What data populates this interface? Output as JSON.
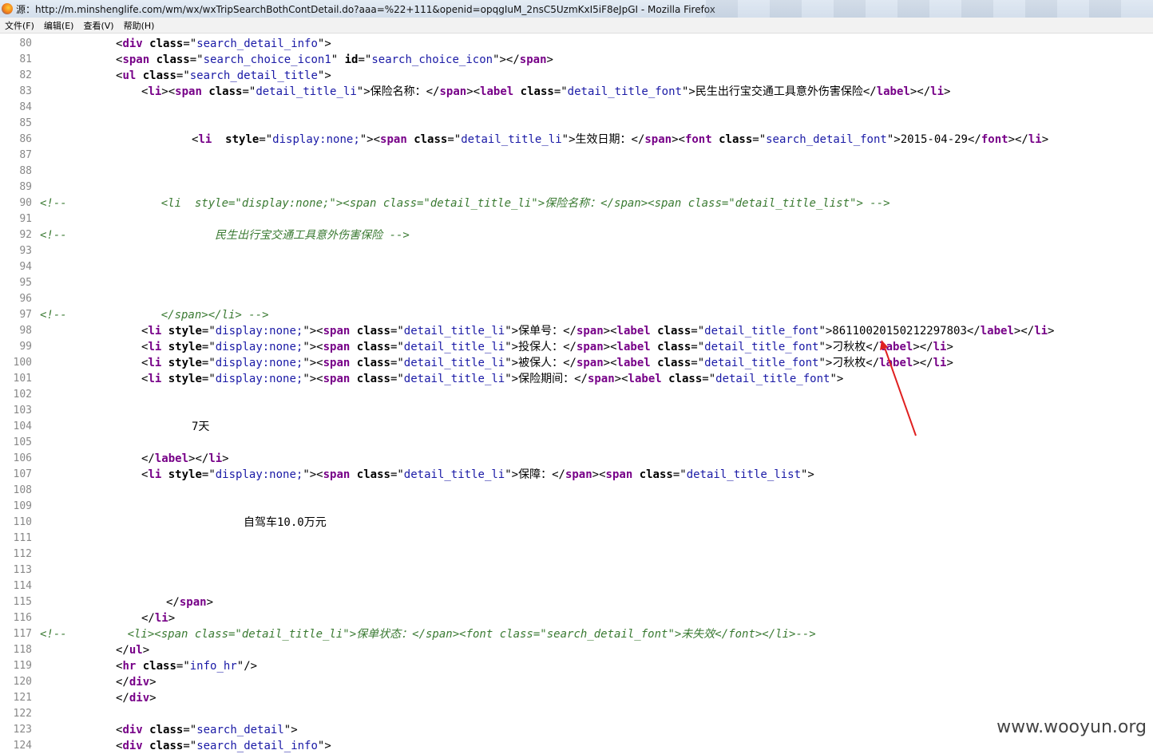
{
  "window": {
    "title": "源：http://m.minshenglife.com/wm/wx/wxTripSearchBothContDetail.do?aaa=%22+111&openid=opqgIuM_2nsC5UzmKxI5iF8eJpGI - Mozilla Firefox"
  },
  "menu": [
    {
      "label": "文件(F)"
    },
    {
      "label": "编辑(E)"
    },
    {
      "label": "查看(V)"
    },
    {
      "label": "帮助(H)"
    }
  ],
  "source_lines": [
    {
      "no": "80",
      "indent": 145,
      "parts": [
        [
          "t",
          "<"
        ],
        [
          "tag",
          "div"
        ],
        [
          "t",
          " "
        ],
        [
          "attr",
          "class"
        ],
        [
          "t",
          "=\""
        ],
        [
          "val",
          "search_detail_info"
        ],
        [
          "t",
          "\">"
        ]
      ]
    },
    {
      "no": "81",
      "indent": 145,
      "parts": [
        [
          "t",
          "<"
        ],
        [
          "tag",
          "span"
        ],
        [
          "t",
          " "
        ],
        [
          "attr",
          "class"
        ],
        [
          "t",
          "=\""
        ],
        [
          "val",
          "search_choice_icon1"
        ],
        [
          "t",
          "\" "
        ],
        [
          "attr",
          "id"
        ],
        [
          "t",
          "=\""
        ],
        [
          "val",
          "search_choice_icon"
        ],
        [
          "t",
          "\"></"
        ],
        [
          "tag",
          "span"
        ],
        [
          "t",
          ">"
        ]
      ]
    },
    {
      "no": "82",
      "indent": 145,
      "parts": [
        [
          "t",
          "<"
        ],
        [
          "tag",
          "ul"
        ],
        [
          "t",
          " "
        ],
        [
          "attr",
          "class"
        ],
        [
          "t",
          "=\""
        ],
        [
          "val",
          "search_detail_title"
        ],
        [
          "t",
          "\">"
        ]
      ]
    },
    {
      "no": "83",
      "indent": 177,
      "parts": [
        [
          "t",
          "<"
        ],
        [
          "tag",
          "li"
        ],
        [
          "t",
          "><"
        ],
        [
          "tag",
          "span"
        ],
        [
          "t",
          " "
        ],
        [
          "attr",
          "class"
        ],
        [
          "t",
          "=\""
        ],
        [
          "val",
          "detail_title_li"
        ],
        [
          "t",
          "\">保险名称：</"
        ],
        [
          "tag",
          "span"
        ],
        [
          "t",
          "><"
        ],
        [
          "tag",
          "label"
        ],
        [
          "t",
          " "
        ],
        [
          "attr",
          "class"
        ],
        [
          "t",
          "=\""
        ],
        [
          "val",
          "detail_title_font"
        ],
        [
          "t",
          "\">民生出行宝交通工具意外伤害保险</"
        ],
        [
          "tag",
          "label"
        ],
        [
          "t",
          "></"
        ],
        [
          "tag",
          "li"
        ],
        [
          "t",
          ">"
        ]
      ]
    },
    {
      "no": "84",
      "indent": 0,
      "parts": []
    },
    {
      "no": "85",
      "indent": 0,
      "parts": []
    },
    {
      "no": "86",
      "indent": 240,
      "parts": [
        [
          "t",
          "<"
        ],
        [
          "tag",
          "li"
        ],
        [
          "t",
          "  "
        ],
        [
          "attr",
          "style"
        ],
        [
          "t",
          "=\""
        ],
        [
          "val",
          "display:none;"
        ],
        [
          "t",
          "\"><"
        ],
        [
          "tag",
          "span"
        ],
        [
          "t",
          " "
        ],
        [
          "attr",
          "class"
        ],
        [
          "t",
          "=\""
        ],
        [
          "val",
          "detail_title_li"
        ],
        [
          "t",
          "\">生效日期：</"
        ],
        [
          "tag",
          "span"
        ],
        [
          "t",
          "><"
        ],
        [
          "tag",
          "font"
        ],
        [
          "t",
          " "
        ],
        [
          "attr",
          "class"
        ],
        [
          "t",
          "=\""
        ],
        [
          "val",
          "search_detail_font"
        ],
        [
          "t",
          "\">2015-04-29</"
        ],
        [
          "tag",
          "font"
        ],
        [
          "t",
          "></"
        ],
        [
          "tag",
          "li"
        ],
        [
          "t",
          ">"
        ]
      ]
    },
    {
      "no": "87",
      "indent": 0,
      "parts": []
    },
    {
      "no": "88",
      "indent": 0,
      "parts": []
    },
    {
      "no": "89",
      "indent": 0,
      "parts": []
    },
    {
      "no": "90",
      "indent": 50,
      "parts": [
        [
          "cmt",
          "<!--              <li  style=\"display:none;\"><span class=\"detail_title_li\">保险名称：</span><span class=\"detail_title_list\"> -->"
        ]
      ]
    },
    {
      "no": "91",
      "indent": 0,
      "parts": []
    },
    {
      "no": "92",
      "indent": 50,
      "parts": [
        [
          "cmt",
          "<!--                      民生出行宝交通工具意外伤害保险 -->"
        ]
      ]
    },
    {
      "no": "93",
      "indent": 0,
      "parts": []
    },
    {
      "no": "94",
      "indent": 0,
      "parts": []
    },
    {
      "no": "95",
      "indent": 0,
      "parts": []
    },
    {
      "no": "96",
      "indent": 0,
      "parts": []
    },
    {
      "no": "97",
      "indent": 50,
      "parts": [
        [
          "cmt",
          "<!--              </span></li> -->"
        ]
      ]
    },
    {
      "no": "98",
      "indent": 177,
      "parts": [
        [
          "t",
          "<"
        ],
        [
          "tag",
          "li"
        ],
        [
          "t",
          " "
        ],
        [
          "attr",
          "style"
        ],
        [
          "t",
          "=\""
        ],
        [
          "val",
          "display:none;"
        ],
        [
          "t",
          "\"><"
        ],
        [
          "tag",
          "span"
        ],
        [
          "t",
          " "
        ],
        [
          "attr",
          "class"
        ],
        [
          "t",
          "=\""
        ],
        [
          "val",
          "detail_title_li"
        ],
        [
          "t",
          "\">保单号：</"
        ],
        [
          "tag",
          "span"
        ],
        [
          "t",
          "><"
        ],
        [
          "tag",
          "label"
        ],
        [
          "t",
          " "
        ],
        [
          "attr",
          "class"
        ],
        [
          "t",
          "=\""
        ],
        [
          "val",
          "detail_title_font"
        ],
        [
          "t",
          "\">86110020150212297803</"
        ],
        [
          "tag",
          "label"
        ],
        [
          "t",
          "></"
        ],
        [
          "tag",
          "li"
        ],
        [
          "t",
          ">"
        ]
      ]
    },
    {
      "no": "99",
      "indent": 177,
      "parts": [
        [
          "t",
          "<"
        ],
        [
          "tag",
          "li"
        ],
        [
          "t",
          " "
        ],
        [
          "attr",
          "style"
        ],
        [
          "t",
          "=\""
        ],
        [
          "val",
          "display:none;"
        ],
        [
          "t",
          "\"><"
        ],
        [
          "tag",
          "span"
        ],
        [
          "t",
          " "
        ],
        [
          "attr",
          "class"
        ],
        [
          "t",
          "=\""
        ],
        [
          "val",
          "detail_title_li"
        ],
        [
          "t",
          "\">投保人：</"
        ],
        [
          "tag",
          "span"
        ],
        [
          "t",
          "><"
        ],
        [
          "tag",
          "label"
        ],
        [
          "t",
          " "
        ],
        [
          "attr",
          "class"
        ],
        [
          "t",
          "=\""
        ],
        [
          "val",
          "detail_title_font"
        ],
        [
          "t",
          "\">刁秋枚</"
        ],
        [
          "tag",
          "label"
        ],
        [
          "t",
          "></"
        ],
        [
          "tag",
          "li"
        ],
        [
          "t",
          ">"
        ]
      ]
    },
    {
      "no": "100",
      "indent": 177,
      "parts": [
        [
          "t",
          "<"
        ],
        [
          "tag",
          "li"
        ],
        [
          "t",
          " "
        ],
        [
          "attr",
          "style"
        ],
        [
          "t",
          "=\""
        ],
        [
          "val",
          "display:none;"
        ],
        [
          "t",
          "\"><"
        ],
        [
          "tag",
          "span"
        ],
        [
          "t",
          " "
        ],
        [
          "attr",
          "class"
        ],
        [
          "t",
          "=\""
        ],
        [
          "val",
          "detail_title_li"
        ],
        [
          "t",
          "\">被保人：</"
        ],
        [
          "tag",
          "span"
        ],
        [
          "t",
          "><"
        ],
        [
          "tag",
          "label"
        ],
        [
          "t",
          " "
        ],
        [
          "attr",
          "class"
        ],
        [
          "t",
          "=\""
        ],
        [
          "val",
          "detail_title_font"
        ],
        [
          "t",
          "\">刁秋枚</"
        ],
        [
          "tag",
          "label"
        ],
        [
          "t",
          "></"
        ],
        [
          "tag",
          "li"
        ],
        [
          "t",
          ">"
        ]
      ]
    },
    {
      "no": "101",
      "indent": 177,
      "parts": [
        [
          "t",
          "<"
        ],
        [
          "tag",
          "li"
        ],
        [
          "t",
          " "
        ],
        [
          "attr",
          "style"
        ],
        [
          "t",
          "=\""
        ],
        [
          "val",
          "display:none;"
        ],
        [
          "t",
          "\"><"
        ],
        [
          "tag",
          "span"
        ],
        [
          "t",
          " "
        ],
        [
          "attr",
          "class"
        ],
        [
          "t",
          "=\""
        ],
        [
          "val",
          "detail_title_li"
        ],
        [
          "t",
          "\">保险期间：</"
        ],
        [
          "tag",
          "span"
        ],
        [
          "t",
          "><"
        ],
        [
          "tag",
          "label"
        ],
        [
          "t",
          " "
        ],
        [
          "attr",
          "class"
        ],
        [
          "t",
          "=\""
        ],
        [
          "val",
          "detail_title_font"
        ],
        [
          "t",
          "\">"
        ]
      ]
    },
    {
      "no": "102",
      "indent": 0,
      "parts": []
    },
    {
      "no": "103",
      "indent": 0,
      "parts": []
    },
    {
      "no": "104",
      "indent": 240,
      "parts": [
        [
          "t",
          "7天"
        ]
      ]
    },
    {
      "no": "105",
      "indent": 0,
      "parts": []
    },
    {
      "no": "106",
      "indent": 177,
      "parts": [
        [
          "t",
          "</"
        ],
        [
          "tag",
          "label"
        ],
        [
          "t",
          "></"
        ],
        [
          "tag",
          "li"
        ],
        [
          "t",
          ">"
        ]
      ]
    },
    {
      "no": "107",
      "indent": 177,
      "parts": [
        [
          "t",
          "<"
        ],
        [
          "tag",
          "li"
        ],
        [
          "t",
          " "
        ],
        [
          "attr",
          "style"
        ],
        [
          "t",
          "=\""
        ],
        [
          "val",
          "display:none;"
        ],
        [
          "t",
          "\"><"
        ],
        [
          "tag",
          "span"
        ],
        [
          "t",
          " "
        ],
        [
          "attr",
          "class"
        ],
        [
          "t",
          "=\""
        ],
        [
          "val",
          "detail_title_li"
        ],
        [
          "t",
          "\">保障：</"
        ],
        [
          "tag",
          "span"
        ],
        [
          "t",
          "><"
        ],
        [
          "tag",
          "span"
        ],
        [
          "t",
          " "
        ],
        [
          "attr",
          "class"
        ],
        [
          "t",
          "=\""
        ],
        [
          "val",
          "detail_title_list"
        ],
        [
          "t",
          "\">"
        ]
      ]
    },
    {
      "no": "108",
      "indent": 0,
      "parts": []
    },
    {
      "no": "109",
      "indent": 0,
      "parts": []
    },
    {
      "no": "110",
      "indent": 305,
      "parts": [
        [
          "t",
          "自驾车10.0万元"
        ]
      ]
    },
    {
      "no": "111",
      "indent": 0,
      "parts": []
    },
    {
      "no": "112",
      "indent": 0,
      "parts": []
    },
    {
      "no": "113",
      "indent": 0,
      "parts": []
    },
    {
      "no": "114",
      "indent": 0,
      "parts": []
    },
    {
      "no": "115",
      "indent": 208,
      "parts": [
        [
          "t",
          "</"
        ],
        [
          "tag",
          "span"
        ],
        [
          "t",
          ">"
        ]
      ]
    },
    {
      "no": "116",
      "indent": 177,
      "parts": [
        [
          "t",
          "</"
        ],
        [
          "tag",
          "li"
        ],
        [
          "t",
          ">"
        ]
      ]
    },
    {
      "no": "117",
      "indent": 50,
      "parts": [
        [
          "cmt",
          "<!--         <li><span class=\"detail_title_li\">保单状态：</span><font class=\"search_detail_font\">未失效</font></li>-->"
        ]
      ]
    },
    {
      "no": "118",
      "indent": 145,
      "parts": [
        [
          "t",
          "</"
        ],
        [
          "tag",
          "ul"
        ],
        [
          "t",
          ">"
        ]
      ]
    },
    {
      "no": "119",
      "indent": 145,
      "parts": [
        [
          "t",
          "<"
        ],
        [
          "tag",
          "hr"
        ],
        [
          "t",
          " "
        ],
        [
          "attr",
          "class"
        ],
        [
          "t",
          "=\""
        ],
        [
          "val",
          "info_hr"
        ],
        [
          "t",
          "\"/>"
        ]
      ]
    },
    {
      "no": "120",
      "indent": 145,
      "parts": [
        [
          "t",
          "</"
        ],
        [
          "tag",
          "div"
        ],
        [
          "t",
          ">"
        ]
      ]
    },
    {
      "no": "121",
      "indent": 145,
      "parts": [
        [
          "t",
          "</"
        ],
        [
          "tag",
          "div"
        ],
        [
          "t",
          ">"
        ]
      ]
    },
    {
      "no": "122",
      "indent": 0,
      "parts": []
    },
    {
      "no": "123",
      "indent": 145,
      "parts": [
        [
          "t",
          "<"
        ],
        [
          "tag",
          "div"
        ],
        [
          "t",
          " "
        ],
        [
          "attr",
          "class"
        ],
        [
          "t",
          "=\""
        ],
        [
          "val",
          "search_detail"
        ],
        [
          "t",
          "\">"
        ]
      ]
    },
    {
      "no": "124",
      "indent": 145,
      "parts": [
        [
          "t",
          "<"
        ],
        [
          "tag",
          "div"
        ],
        [
          "t",
          " "
        ],
        [
          "attr",
          "class"
        ],
        [
          "t",
          "=\""
        ],
        [
          "val",
          "search_detail_info"
        ],
        [
          "t",
          "\">"
        ]
      ]
    }
  ],
  "annotation": {
    "color": "#e02020"
  },
  "watermark": "www.wooyun.org"
}
